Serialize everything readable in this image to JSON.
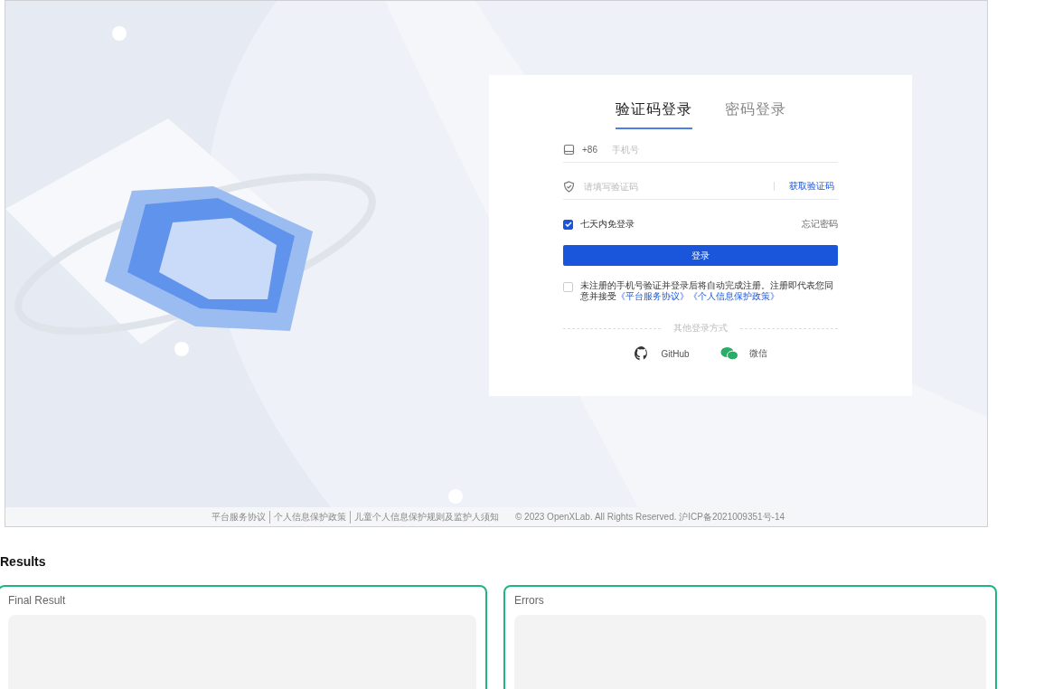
{
  "login": {
    "tabs": [
      {
        "label": "验证码登录",
        "selected": true
      },
      {
        "label": "密码登录",
        "selected": false
      }
    ],
    "phone": {
      "prefix": "+86",
      "placeholder": "手机号"
    },
    "code": {
      "placeholder": "请填写验证码",
      "action": "获取验证码"
    },
    "remember": {
      "label": "七天内免登录",
      "checked": true
    },
    "forgot": "忘记密码",
    "submit": "登录",
    "agreement": {
      "checked": false,
      "text": "未注册的手机号验证并登录后将自动完成注册。注册即代表您同意并接受",
      "links": [
        "《平台服务协议》",
        "《个人信息保护政策》"
      ]
    },
    "other_label": "其他登录方式",
    "social": [
      {
        "label": "GitHub",
        "kind": "github"
      },
      {
        "label": "微信",
        "kind": "wechat"
      }
    ]
  },
  "footer": {
    "links": [
      "平台服务协议",
      "个人信息保护政策",
      "儿童个人信息保护规则及监护人须知"
    ],
    "copyright": "© 2023 OpenXLab. All Rights Reserved. 沪ICP备2021009351号-14"
  },
  "results": {
    "title": "Results",
    "panels": [
      {
        "label": "Final Result"
      },
      {
        "label": "Errors"
      }
    ]
  }
}
